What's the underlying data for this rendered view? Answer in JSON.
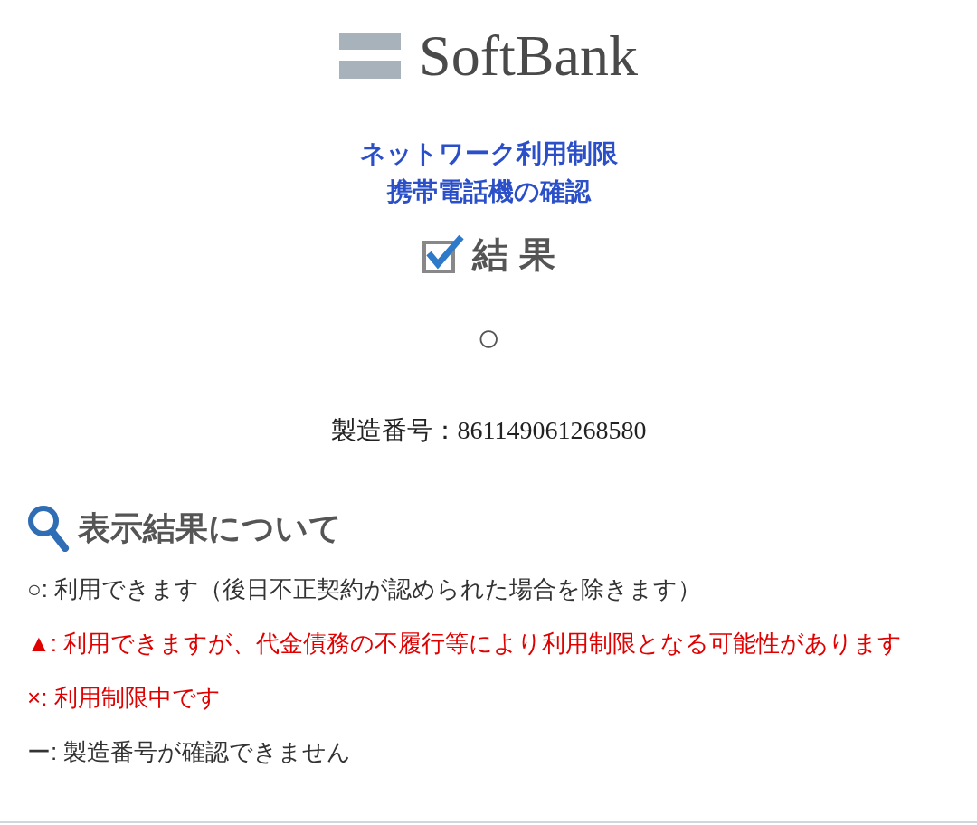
{
  "logo": {
    "text": "SoftBank"
  },
  "title_lines": [
    "ネットワーク利用制限",
    "携帯電話機の確認"
  ],
  "result_heading": {
    "text": "結 果"
  },
  "result": {
    "symbol": "○",
    "serial": "製造番号：861149061268580"
  },
  "legend_heading": {
    "text": "表示結果について"
  },
  "legend": [
    {
      "mark": "○",
      "text": ": 利用できます（後日不正契約が認められた場合を除きます）",
      "color": "#333333"
    },
    {
      "mark": "▲",
      "text": ": 利用できますが、代金債務の不履行等により利用制限となる可能性があります",
      "color": "#e00000"
    },
    {
      "mark": "×",
      "text": ": 利用制限中です",
      "color": "#e00000"
    },
    {
      "mark": "ー",
      "text": ": 製造番号が確認できません",
      "color": "#333333"
    }
  ]
}
